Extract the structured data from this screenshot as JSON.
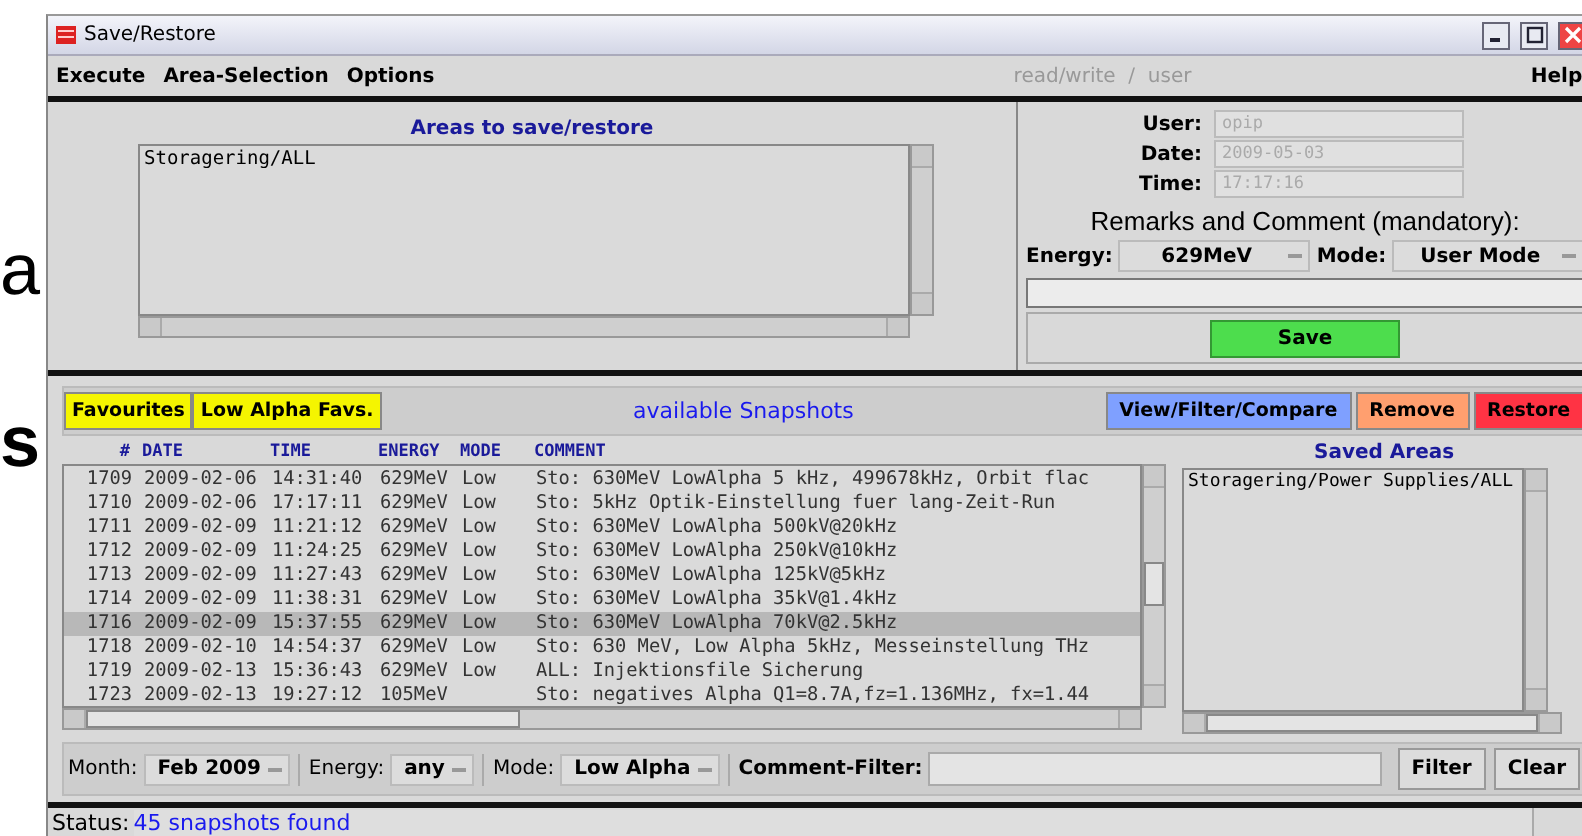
{
  "backdrop": {
    "texts": [
      "a",
      "s"
    ]
  },
  "window": {
    "title": "Save/Restore"
  },
  "menu": {
    "items": [
      "Execute",
      "Area-Selection",
      "Options"
    ],
    "access": "read/write  /  user",
    "help": "Help"
  },
  "areas": {
    "title": "Areas to save/restore",
    "items": [
      "Storagering/ALL"
    ]
  },
  "info": {
    "fields": [
      {
        "label": "User:",
        "value": "opip"
      },
      {
        "label": "Date:",
        "value": "2009-05-03"
      },
      {
        "label": "Time:",
        "value": "17:17:16"
      }
    ],
    "remarks_title": "Remarks and Comment (mandatory):",
    "energy": {
      "label": "Energy:",
      "value": "629MeV"
    },
    "mode": {
      "label": "Mode:",
      "value": "User Mode"
    },
    "save": "Save"
  },
  "snapshots": {
    "favourites": [
      "Favourites",
      "Low Alpha Favs."
    ],
    "title": "available Snapshots",
    "actions": [
      {
        "label": "View/Filter/Compare",
        "color": "#7fa0ff"
      },
      {
        "label": "Remove",
        "color": "#ff9f6f"
      },
      {
        "label": "Restore",
        "color": "#ff3344"
      }
    ],
    "columns": [
      "#",
      "DATE",
      "TIME",
      "ENERGY",
      "MODE",
      "COMMENT"
    ],
    "rows": [
      {
        "cells": [
          "1709",
          "2009-02-06",
          "14:31:40",
          "629MeV",
          "Low",
          "Sto: 630MeV LowAlpha 5 kHz, 499678kHz, Orbit flac"
        ],
        "selected": false
      },
      {
        "cells": [
          "1710",
          "2009-02-06",
          "17:17:11",
          "629MeV",
          "Low",
          "Sto: 5kHz Optik-Einstellung fuer lang-Zeit-Run"
        ],
        "selected": false
      },
      {
        "cells": [
          "1711",
          "2009-02-09",
          "11:21:12",
          "629MeV",
          "Low",
          "Sto: 630MeV LowAlpha 500kV@20kHz"
        ],
        "selected": false
      },
      {
        "cells": [
          "1712",
          "2009-02-09",
          "11:24:25",
          "629MeV",
          "Low",
          "Sto: 630MeV LowAlpha 250kV@10kHz"
        ],
        "selected": false
      },
      {
        "cells": [
          "1713",
          "2009-02-09",
          "11:27:43",
          "629MeV",
          "Low",
          "Sto: 630MeV LowAlpha 125kV@5kHz"
        ],
        "selected": false
      },
      {
        "cells": [
          "1714",
          "2009-02-09",
          "11:38:31",
          "629MeV",
          "Low",
          "Sto: 630MeV LowAlpha 35kV@1.4kHz"
        ],
        "selected": false
      },
      {
        "cells": [
          "1716",
          "2009-02-09",
          "15:37:55",
          "629MeV",
          "Low",
          "Sto: 630MeV LowAlpha 70kV@2.5kHz"
        ],
        "selected": true
      },
      {
        "cells": [
          "1718",
          "2009-02-10",
          "14:54:37",
          "629MeV",
          "Low",
          "Sto: 630 MeV, Low Alpha 5kHz, Messeinstellung THz"
        ],
        "selected": false
      },
      {
        "cells": [
          "1719",
          "2009-02-13",
          "15:36:43",
          "629MeV",
          "Low",
          "ALL: Injektionsfile Sicherung"
        ],
        "selected": false
      },
      {
        "cells": [
          "1723",
          "2009-02-13",
          "19:27:12",
          "105MeV",
          "",
          "Sto: negatives Alpha Q1=8.7A,fz=1.136MHz, fx=1.44"
        ],
        "selected": false
      }
    ],
    "saved_title": "Saved Areas",
    "saved_items": [
      "Storagering/Power Supplies/ALL"
    ]
  },
  "filters": {
    "month": {
      "label": "Month:",
      "value": "Feb 2009"
    },
    "energy": {
      "label": "Energy:",
      "value": "any"
    },
    "mode": {
      "label": "Mode:",
      "value": "Low Alpha"
    },
    "comment_label": "Comment-Filter:",
    "buttons": [
      "Filter",
      "Clear"
    ]
  },
  "status": {
    "label": "Status:",
    "text": "45 snapshots found"
  }
}
